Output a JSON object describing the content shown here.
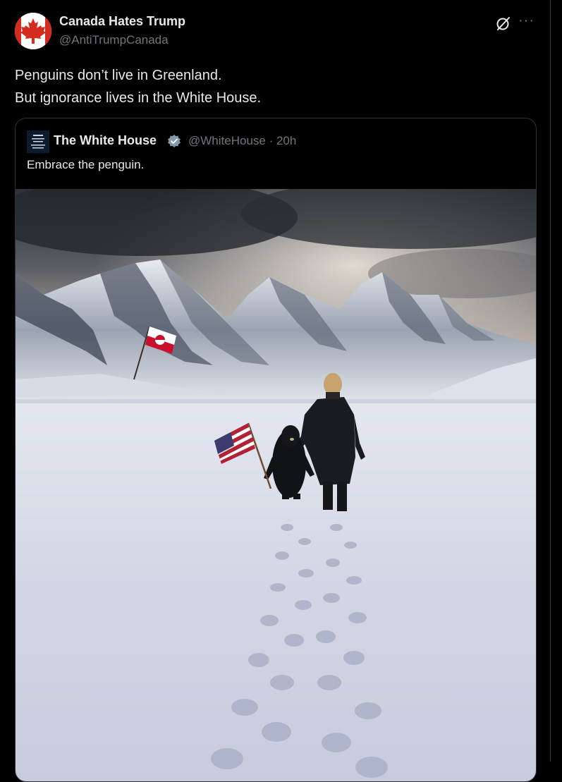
{
  "post": {
    "author_name": "Canada Hates Trump",
    "author_handle": "@AntiTrumpCanada",
    "text_lines": [
      "Penguins don’t live in Greenland.",
      "But ignorance lives in the White House."
    ]
  },
  "quoted": {
    "author_name": "The White House",
    "handle_time": "@WhiteHouse · 20h",
    "text": "Embrace the penguin."
  },
  "icons": {
    "grok": "grok-icon",
    "more": "more-icon",
    "verified": "verified-badge-icon",
    "avatar_flag": "maple-leaf-icon"
  },
  "colors": {
    "background": "#000000",
    "text": "#e7e9ea",
    "secondary": "#71767b",
    "border": "#2f3336",
    "maple_red": "#d52b1e"
  }
}
